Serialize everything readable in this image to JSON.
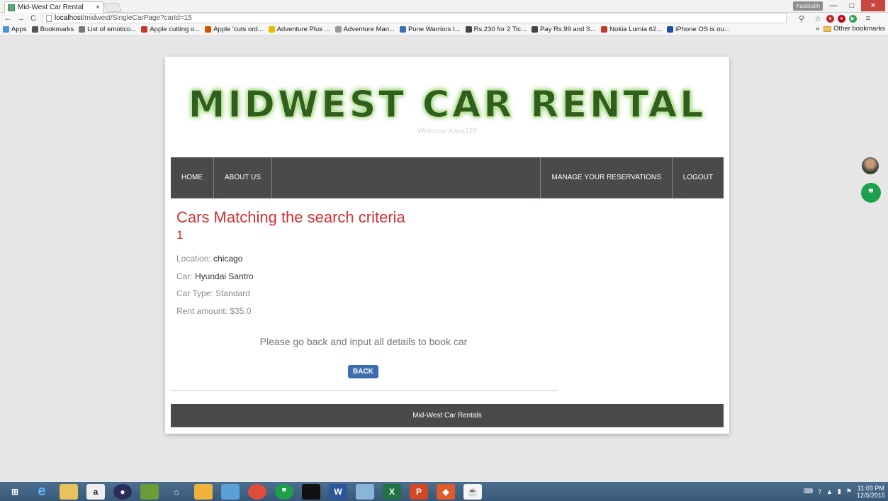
{
  "browser": {
    "tab_title": "Mid-West Car Rental",
    "tab_close": "×",
    "user_badge": "Kaustubh",
    "win_minimize": "—",
    "win_maximize": "□",
    "win_close": "×",
    "url_host": "localhost",
    "url_path": "/midwest/SingleCarPage?carId=15",
    "bookmarks": [
      {
        "label": "Apps",
        "color": "#4a90d9"
      },
      {
        "label": "Bookmarks",
        "color": "#555555"
      },
      {
        "label": "List of emotico...",
        "color": "#777777"
      },
      {
        "label": "Apple cutting o...",
        "color": "#c0392b"
      },
      {
        "label": "Apple 'cuts ord...",
        "color": "#d35400"
      },
      {
        "label": "Adventure Plus ...",
        "color": "#e6b800"
      },
      {
        "label": "Adventure Man...",
        "color": "#999999"
      },
      {
        "label": "Pune Warriors I...",
        "color": "#3a6fb0"
      },
      {
        "label": "Rs.230 for 2 Tic...",
        "color": "#444444"
      },
      {
        "label": "Pay Rs.99 and S...",
        "color": "#444444"
      },
      {
        "label": "Nokia Lumia 62...",
        "color": "#c0392b"
      },
      {
        "label": "iPhone OS is ou...",
        "color": "#1f4e9c"
      }
    ],
    "bookmarks_more": "»",
    "other_bookmarks": "Other bookmarks"
  },
  "site": {
    "logo": "MIDWEST CAR RENTAL",
    "welcome": "Welcome Kaus123",
    "nav": {
      "home": "HOME",
      "about": "ABOUT US",
      "manage": "MANAGE YOUR RESERVATIONS",
      "logout": "LOGOUT"
    },
    "heading": "Cars Matching the search criteria",
    "count": "1",
    "details": {
      "location_label": "Location: ",
      "location_value": "chicago",
      "car_label": "Car: ",
      "car_value": "Hyundai Santro",
      "type_label": "Car Type: ",
      "type_value": "Standard",
      "rent_label": "Rent amount: ",
      "rent_value": "$35.0"
    },
    "message": "Please go back and input all details to book car",
    "back_button": "BACK",
    "footer": "Mid-West Car Rentals"
  },
  "taskbar": {
    "time": "11:03 PM",
    "date": "12/5/2015"
  }
}
